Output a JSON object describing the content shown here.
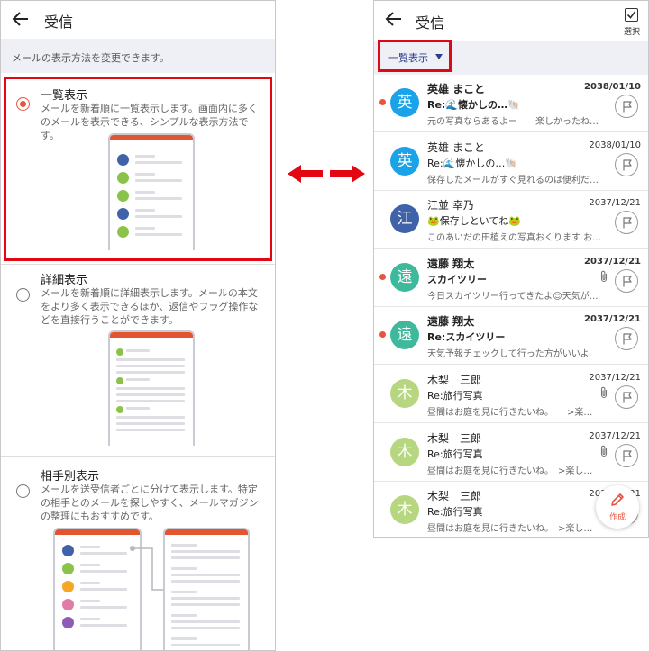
{
  "left": {
    "header": {
      "title": "受信"
    },
    "band_text": "メールの表示方法を変更できます。",
    "options": [
      {
        "title": "一覧表示",
        "selected": true,
        "desc": "メールを新着順に一覧表示します。画面内に多くのメールを表示できる、シンプルな表示方法です。"
      },
      {
        "title": "詳細表示",
        "selected": false,
        "desc": "メールを新着順に詳細表示します。メールの本文をより多く表示できるほか、返信やフラグ操作などを直接行うことができます。"
      },
      {
        "title": "相手別表示",
        "selected": false,
        "desc": "メールを送受信者ごとに分けて表示します。特定の相手とのメールを探しやすく、メールマガジンの整理にもおすすめです。"
      }
    ]
  },
  "right": {
    "header": {
      "title": "受信",
      "select_label": "選択"
    },
    "view_mode_label": "一覧表示",
    "compose_label": "作成",
    "mails": [
      {
        "initial": "英",
        "avatar_color": "#1aa3e8",
        "sender": "英雄 まこと",
        "date": "2038/01/10",
        "subject": "Re:🌊懐かしの…🐚",
        "preview": "元の写真ならあるよー　　楽しかったね…",
        "unread": true,
        "attachment": false,
        "bold": true
      },
      {
        "initial": "英",
        "avatar_color": "#1aa3e8",
        "sender": "英雄 まこと",
        "date": "2038/01/10",
        "subject": "Re:🌊懐かしの…🐚",
        "preview": "保存したメールがすぐ見れるのは便利だ…",
        "unread": false,
        "attachment": false,
        "bold": false
      },
      {
        "initial": "江",
        "avatar_color": "#3f62a8",
        "sender": "江並 幸乃",
        "date": "2037/12/21",
        "subject": "🐸保存しといてね🐸",
        "preview": "このあいだの田植えの写真おくります お…",
        "unread": false,
        "attachment": false,
        "bold": false
      },
      {
        "initial": "遠",
        "avatar_color": "#3fb99b",
        "sender": "遠藤 翔太",
        "date": "2037/12/21",
        "subject": "スカイツリー",
        "preview": "今日スカイツリー行ってきたよ😊天気が…",
        "unread": true,
        "attachment": true,
        "bold": true
      },
      {
        "initial": "遠",
        "avatar_color": "#3fb99b",
        "sender": "遠藤 翔太",
        "date": "2037/12/21",
        "subject": "Re:スカイツリー",
        "preview": "天気予報チェックして行った方がいいよ",
        "unread": true,
        "attachment": false,
        "bold": true
      },
      {
        "initial": "木",
        "avatar_color": "#b6d77f",
        "sender": "木梨　三郎",
        "date": "2037/12/21",
        "subject": "Re:旅行写真",
        "preview": "昼間はお庭を見に行きたいね。　　>楽…",
        "unread": false,
        "attachment": true,
        "bold": false
      },
      {
        "initial": "木",
        "avatar_color": "#b6d77f",
        "sender": "木梨　三郎",
        "date": "2037/12/21",
        "subject": "Re:旅行写真",
        "preview": "昼間はお庭を見に行きたいね。　>楽し…",
        "unread": false,
        "attachment": true,
        "bold": false
      },
      {
        "initial": "木",
        "avatar_color": "#b6d77f",
        "sender": "木梨　三郎",
        "date": "2037/12/21",
        "subject": "Re:旅行写真",
        "preview": "昼間はお庭を見に行きたいね。　>楽し…",
        "unread": false,
        "attachment": true,
        "bold": false
      }
    ]
  },
  "colors": {
    "accent": "#e8533f",
    "highlight_frame": "#e30613",
    "arrow": "#e30613",
    "link": "#2c3e8c"
  },
  "icons": [
    "back-arrow-icon",
    "radio-icon",
    "double-arrow-icon",
    "checkbox-icon",
    "flag-icon",
    "paperclip-icon",
    "pencil-icon"
  ]
}
